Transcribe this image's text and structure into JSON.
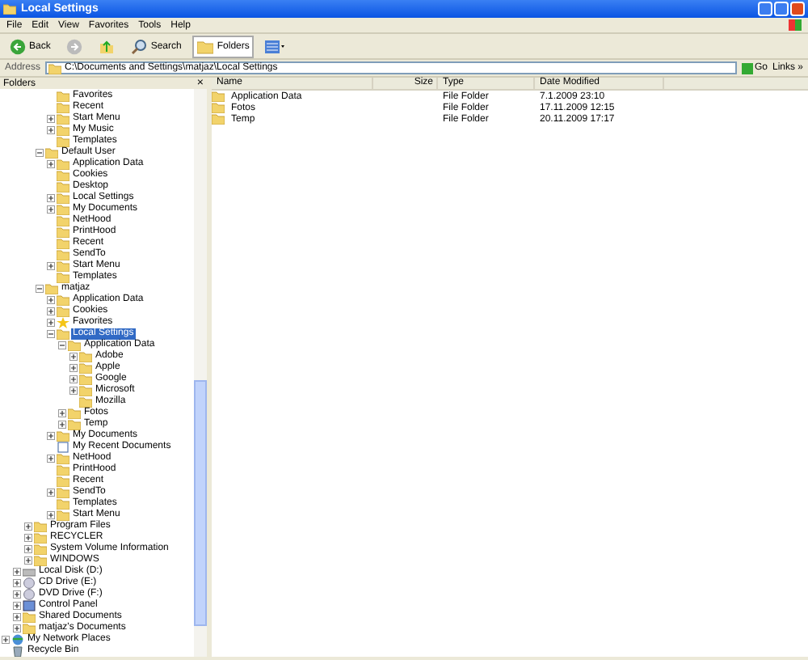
{
  "window": {
    "title": "Local Settings"
  },
  "menu": [
    "File",
    "Edit",
    "View",
    "Favorites",
    "Tools",
    "Help"
  ],
  "toolbar": [
    {
      "kind": "back",
      "label": "Back"
    },
    {
      "kind": "forward"
    },
    {
      "kind": "up"
    },
    {
      "kind": "search",
      "label": "Search",
      "selected": false
    },
    {
      "kind": "folders",
      "label": "Folders",
      "selected": true
    },
    {
      "kind": "views"
    }
  ],
  "address": {
    "label": "Address",
    "value": "C:\\Documents and Settings\\matjaz\\Local Settings",
    "go": "Go",
    "links": "Links »"
  },
  "folders_pane": {
    "title": "Folders",
    "close": "×"
  },
  "tree": [
    {
      "children": [
        {
          "children": [
            {
              "children": [
                {
                  "children": [
                    {
                      "label": "Favorites",
                      "kind": "folder",
                      "selected": false
                    },
                    {
                      "label": "Recent",
                      "kind": "folder",
                      "selected": false
                    },
                    {
                      "label": "Start Menu",
                      "kind": "folder",
                      "expanded": false,
                      "selected": false
                    },
                    {
                      "label": "My Music",
                      "kind": "folder",
                      "expanded": false,
                      "selected": false
                    },
                    {
                      "label": "Templates",
                      "kind": "folder",
                      "selected": false
                    }
                  ]
                },
                {
                  "label": "Default User",
                  "kind": "folder",
                  "expanded": true,
                  "selected": false,
                  "children": [
                    {
                      "label": "Application Data",
                      "kind": "folder",
                      "expanded": false,
                      "selected": false
                    },
                    {
                      "label": "Cookies",
                      "kind": "folder",
                      "selected": false
                    },
                    {
                      "label": "Desktop",
                      "kind": "folder",
                      "selected": false
                    },
                    {
                      "label": "Local Settings",
                      "kind": "folder",
                      "expanded": false,
                      "selected": false
                    },
                    {
                      "label": "My Documents",
                      "kind": "folder",
                      "expanded": false,
                      "selected": false
                    },
                    {
                      "label": "NetHood",
                      "kind": "folder",
                      "selected": false
                    },
                    {
                      "label": "PrintHood",
                      "kind": "folder",
                      "selected": false
                    },
                    {
                      "label": "Recent",
                      "kind": "folder",
                      "selected": false
                    },
                    {
                      "label": "SendTo",
                      "kind": "folder",
                      "selected": false
                    },
                    {
                      "label": "Start Menu",
                      "kind": "folder",
                      "expanded": false,
                      "selected": false
                    },
                    {
                      "label": "Templates",
                      "kind": "folder",
                      "selected": false
                    }
                  ]
                },
                {
                  "label": "matjaz",
                  "kind": "folder",
                  "expanded": true,
                  "selected": false,
                  "children": [
                    {
                      "label": "Application Data",
                      "kind": "folder",
                      "expanded": false,
                      "selected": false
                    },
                    {
                      "label": "Cookies",
                      "kind": "folder",
                      "expanded": false,
                      "selected": false
                    },
                    {
                      "label": "Favorites",
                      "kind": "favorites",
                      "expanded": false,
                      "selected": false
                    },
                    {
                      "label": "Local Settings",
                      "kind": "folder",
                      "expanded": true,
                      "selected": true,
                      "children": [
                        {
                          "label": "Application Data",
                          "kind": "folder",
                          "expanded": true,
                          "selected": false,
                          "children": [
                            {
                              "label": "Adobe",
                              "kind": "folder",
                              "expanded": false,
                              "selected": false
                            },
                            {
                              "label": "Apple",
                              "kind": "folder",
                              "expanded": false,
                              "selected": false
                            },
                            {
                              "label": "Google",
                              "kind": "folder",
                              "expanded": false,
                              "selected": false
                            },
                            {
                              "label": "Microsoft",
                              "kind": "folder",
                              "expanded": false,
                              "selected": false
                            },
                            {
                              "label": "Mozilla",
                              "kind": "folder",
                              "selected": false
                            }
                          ]
                        },
                        {
                          "label": "Fotos",
                          "kind": "folder",
                          "expanded": false,
                          "selected": false
                        },
                        {
                          "label": "Temp",
                          "kind": "folder",
                          "expanded": false,
                          "selected": false
                        }
                      ]
                    },
                    {
                      "label": "My Documents",
                      "kind": "folder",
                      "expanded": false,
                      "selected": false
                    },
                    {
                      "label": "My Recent Documents",
                      "kind": "recent",
                      "selected": false
                    },
                    {
                      "label": "NetHood",
                      "kind": "folder",
                      "expanded": false,
                      "selected": false
                    },
                    {
                      "label": "PrintHood",
                      "kind": "folder",
                      "selected": false
                    },
                    {
                      "label": "Recent",
                      "kind": "folder",
                      "selected": false
                    },
                    {
                      "label": "SendTo",
                      "kind": "folder",
                      "expanded": false,
                      "selected": false
                    },
                    {
                      "label": "Templates",
                      "kind": "folder",
                      "selected": false
                    },
                    {
                      "label": "Start Menu",
                      "kind": "folder",
                      "expanded": false,
                      "selected": false
                    }
                  ]
                }
              ]
            },
            {
              "label": "Program Files",
              "kind": "folder",
              "expanded": false,
              "selected": false
            },
            {
              "label": "RECYCLER",
              "kind": "folder",
              "expanded": false,
              "selected": false
            },
            {
              "label": "System Volume Information",
              "kind": "folder",
              "expanded": false,
              "selected": false
            },
            {
              "label": "WINDOWS",
              "kind": "folder",
              "expanded": false,
              "selected": false
            }
          ]
        },
        {
          "label": "Local Disk (D:)",
          "kind": "drive",
          "expanded": false,
          "selected": false
        },
        {
          "label": "CD Drive (E:)",
          "kind": "cd",
          "expanded": false,
          "selected": false
        },
        {
          "label": "DVD Drive (F:)",
          "kind": "cd",
          "expanded": false,
          "selected": false
        },
        {
          "label": "Control Panel",
          "kind": "control",
          "expanded": false,
          "selected": false
        },
        {
          "label": "Shared Documents",
          "kind": "folder",
          "expanded": false,
          "selected": false
        },
        {
          "label": "matjaz's Documents",
          "kind": "folder",
          "expanded": false,
          "selected": false
        }
      ]
    },
    {
      "label": "My Network Places",
      "kind": "network",
      "expanded": false,
      "selected": false
    },
    {
      "label": "Recycle Bin",
      "kind": "recycle",
      "selected": false
    }
  ],
  "list": {
    "columns": [
      "Name",
      "Size",
      "Type",
      "Date Modified"
    ],
    "rows": [
      {
        "name": "Application Data",
        "type": "File Folder",
        "date": "7.1.2009 23:10",
        "selected": false
      },
      {
        "name": "Fotos",
        "type": "File Folder",
        "date": "17.11.2009 12:15",
        "selected": false
      },
      {
        "name": "Temp",
        "type": "File Folder",
        "date": "20.11.2009 17:17",
        "selected": false
      }
    ]
  }
}
